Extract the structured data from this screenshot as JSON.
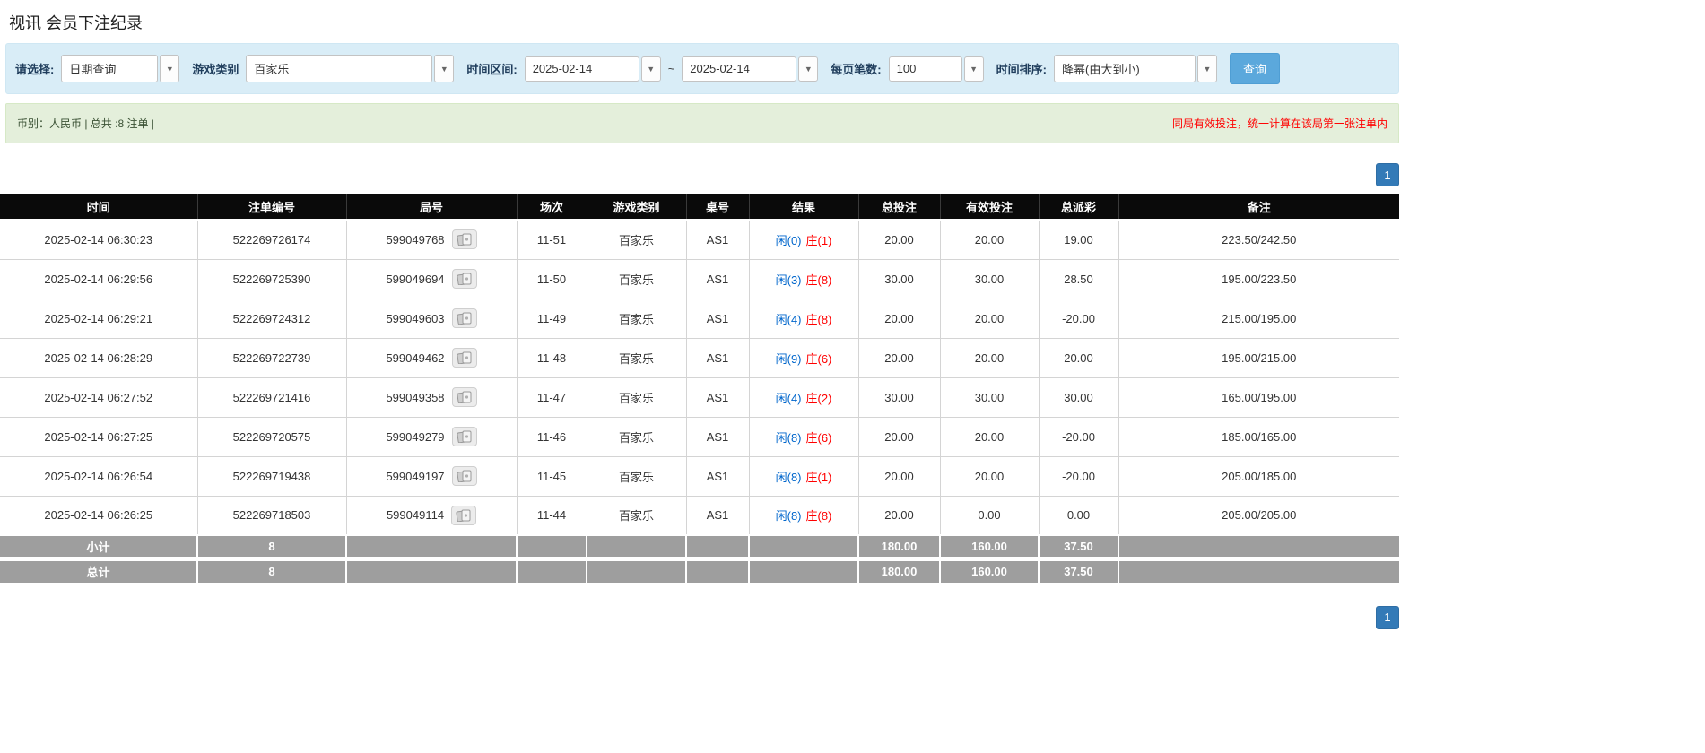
{
  "page": {
    "title": "视讯 会员下注纪录"
  },
  "colors": {
    "accent_blue": "#337ab7",
    "player_blue": "#0066cc",
    "banker_red": "#ff0000",
    "negative_red": "#ff0000",
    "filter_bar_bg": "#d9edf7",
    "info_bar_bg": "#e4efdb",
    "header_bg": "#0a0a0a",
    "summary_bg": "#9e9e9e",
    "search_button_bg": "#5ba8dc"
  },
  "filters": {
    "select_label": "请选择:",
    "select_value": "日期查询",
    "game_label": "游戏类别",
    "game_value": "百家乐",
    "range_label": "时间区间:",
    "date_from": "2025-02-14",
    "range_tilde": "~",
    "date_to": "2025-02-14",
    "per_page_label": "每页笔数:",
    "per_page_value": "100",
    "sort_label": "时间排序:",
    "sort_value": "降幂(由大到小)",
    "search_button": "查询"
  },
  "info": {
    "summary": "币别：人民币 | 总共 :8 注单 |",
    "notice": "同局有效投注，统一计算在该局第一张注单内"
  },
  "pagination": {
    "page": "1"
  },
  "table": {
    "headers": [
      "时间",
      "注单编号",
      "局号",
      "场次",
      "游戏类别",
      "桌号",
      "结果",
      "总投注",
      "有效投注",
      "总派彩",
      "备注"
    ],
    "rows": [
      {
        "time": "2025-02-14 06:30:23",
        "bet_id": "522269726174",
        "round_id": "599049768",
        "session": "11-51",
        "game": "百家乐",
        "table_no": "AS1",
        "result_xian": "闲(0)",
        "result_zhuang": "庄(1)",
        "total_bet": "20.00",
        "valid_bet": "20.00",
        "payout": "19.00",
        "remark": "223.50/242.50"
      },
      {
        "time": "2025-02-14 06:29:56",
        "bet_id": "522269725390",
        "round_id": "599049694",
        "session": "11-50",
        "game": "百家乐",
        "table_no": "AS1",
        "result_xian": "闲(3)",
        "result_zhuang": "庄(8)",
        "total_bet": "30.00",
        "valid_bet": "30.00",
        "payout": "28.50",
        "remark": "195.00/223.50"
      },
      {
        "time": "2025-02-14 06:29:21",
        "bet_id": "522269724312",
        "round_id": "599049603",
        "session": "11-49",
        "game": "百家乐",
        "table_no": "AS1",
        "result_xian": "闲(4)",
        "result_zhuang": "庄(8)",
        "total_bet": "20.00",
        "valid_bet": "20.00",
        "payout": "-20.00",
        "remark": "215.00/195.00"
      },
      {
        "time": "2025-02-14 06:28:29",
        "bet_id": "522269722739",
        "round_id": "599049462",
        "session": "11-48",
        "game": "百家乐",
        "table_no": "AS1",
        "result_xian": "闲(9)",
        "result_zhuang": "庄(6)",
        "total_bet": "20.00",
        "valid_bet": "20.00",
        "payout": "20.00",
        "remark": "195.00/215.00"
      },
      {
        "time": "2025-02-14 06:27:52",
        "bet_id": "522269721416",
        "round_id": "599049358",
        "session": "11-47",
        "game": "百家乐",
        "table_no": "AS1",
        "result_xian": "闲(4)",
        "result_zhuang": "庄(2)",
        "total_bet": "30.00",
        "valid_bet": "30.00",
        "payout": "30.00",
        "remark": "165.00/195.00"
      },
      {
        "time": "2025-02-14 06:27:25",
        "bet_id": "522269720575",
        "round_id": "599049279",
        "session": "11-46",
        "game": "百家乐",
        "table_no": "AS1",
        "result_xian": "闲(8)",
        "result_zhuang": "庄(6)",
        "total_bet": "20.00",
        "valid_bet": "20.00",
        "payout": "-20.00",
        "remark": "185.00/165.00"
      },
      {
        "time": "2025-02-14 06:26:54",
        "bet_id": "522269719438",
        "round_id": "599049197",
        "session": "11-45",
        "game": "百家乐",
        "table_no": "AS1",
        "result_xian": "闲(8)",
        "result_zhuang": "庄(1)",
        "total_bet": "20.00",
        "valid_bet": "20.00",
        "payout": "-20.00",
        "remark": "205.00/185.00"
      },
      {
        "time": "2025-02-14 06:26:25",
        "bet_id": "522269718503",
        "round_id": "599049114",
        "session": "11-44",
        "game": "百家乐",
        "table_no": "AS1",
        "result_xian": "闲(8)",
        "result_zhuang": "庄(8)",
        "total_bet": "20.00",
        "valid_bet": "0.00",
        "payout": "0.00",
        "remark": "205.00/205.00"
      }
    ],
    "subtotal": {
      "label": "小计",
      "count": "8",
      "total_bet": "180.00",
      "valid_bet": "160.00",
      "payout": "37.50"
    },
    "total": {
      "label": "总计",
      "count": "8",
      "total_bet": "180.00",
      "valid_bet": "160.00",
      "payout": "37.50"
    }
  }
}
